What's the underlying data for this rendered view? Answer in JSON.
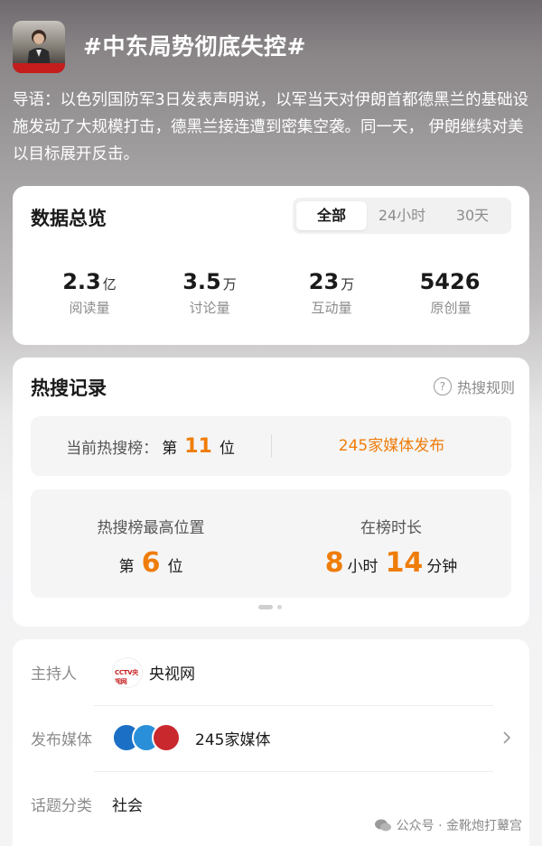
{
  "topic": {
    "title": "#中东局势彻底失控#",
    "intro": "导语：以色列国防军3日发表声明说，以军当天对伊朗首都德黑兰的基础设施发动了大规模打击，德黑兰接连遭到密集空袭。同一天， 伊朗继续对美以目标展开反击。",
    "thumb_icon": "news-anchor-thumbnail"
  },
  "overview": {
    "title": "数据总览",
    "tabs": [
      "全部",
      "24小时",
      "30天"
    ],
    "active_tab": "全部",
    "stats": [
      {
        "value": "2.3",
        "unit": "亿",
        "label": "阅读量"
      },
      {
        "value": "3.5",
        "unit": "万",
        "label": "讨论量"
      },
      {
        "value": "23",
        "unit": "万",
        "label": "互动量"
      },
      {
        "value": "5426",
        "unit": "",
        "label": "原创量"
      }
    ]
  },
  "hot": {
    "title": "热搜记录",
    "rules_label": "热搜规则",
    "current_prefix": "当前热搜榜：",
    "current_di": "第",
    "current_rank": "11",
    "current_wei": "位",
    "media_publish": "245家媒体发布",
    "peak_label": "热搜榜最高位置",
    "peak_di": "第",
    "peak_rank": "6",
    "peak_wei": "位",
    "duration_label": "在榜时长",
    "duration_hours": "8",
    "duration_hours_unit": "小时",
    "duration_minutes": "14",
    "duration_minutes_unit": "分钟"
  },
  "info": {
    "host_label": "主持人",
    "host_logo_text": "CCTV央视网",
    "host_name": "央视网",
    "media_label": "发布媒体",
    "media_count": "245家媒体",
    "category_label": "话题分类",
    "category": "社会"
  },
  "watermark": "公众号 · 金靴炮打鼙宫",
  "colors": {
    "accent_orange": "#ef7d0a",
    "cctv_red": "#c51d1d"
  }
}
